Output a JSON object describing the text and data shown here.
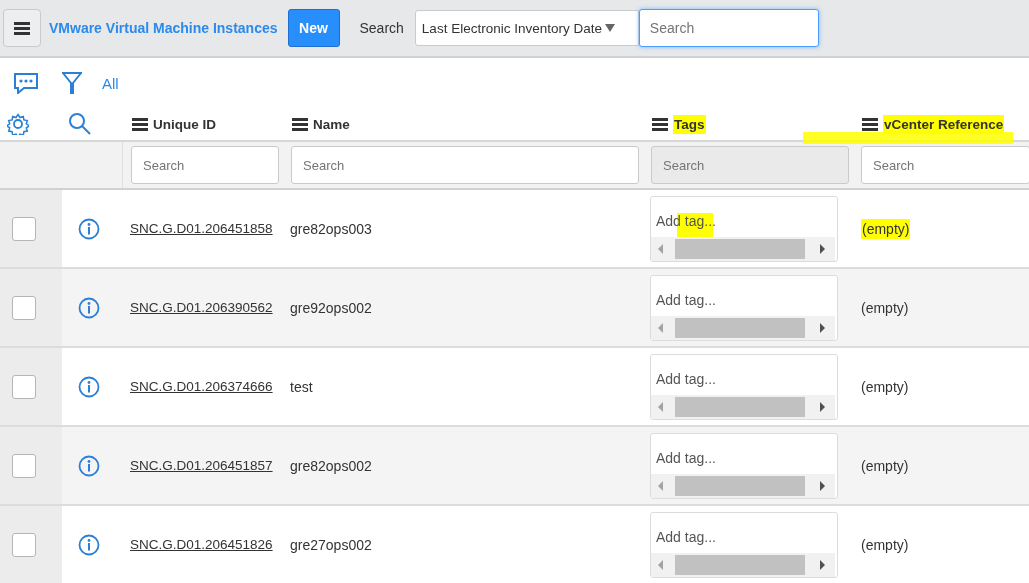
{
  "header": {
    "title": "VMware Virtual Machine Instances",
    "new_button": "New",
    "search_label": "Search",
    "search_field": "Last Electronic Inventory Date",
    "search_placeholder": "Search"
  },
  "breadcrumb": "All",
  "columns": [
    {
      "label": "Unique ID",
      "filter_placeholder": "Search",
      "filter_disabled": false,
      "highlighted": false
    },
    {
      "label": "Name",
      "filter_placeholder": "Search",
      "filter_disabled": false,
      "highlighted": false
    },
    {
      "label": "Tags",
      "filter_placeholder": "Search",
      "filter_disabled": true,
      "highlighted": true
    },
    {
      "label": "vCenter Reference",
      "filter_placeholder": "Search",
      "filter_disabled": false,
      "highlighted": true
    }
  ],
  "rows": [
    {
      "checked": false,
      "unique_id": "SNC.G.D01.206451858",
      "name": "gre82ops003",
      "tag_placeholder": "Add tag...",
      "tag_highlighted": true,
      "vcenter": "(empty)",
      "vcenter_highlighted": true
    },
    {
      "checked": false,
      "unique_id": "SNC.G.D01.206390562",
      "name": "gre92ops002",
      "tag_placeholder": "Add tag...",
      "tag_highlighted": false,
      "vcenter": "(empty)",
      "vcenter_highlighted": false
    },
    {
      "checked": false,
      "unique_id": "SNC.G.D01.206374666",
      "name": "test",
      "tag_placeholder": "Add tag...",
      "tag_highlighted": false,
      "vcenter": "(empty)",
      "vcenter_highlighted": false
    },
    {
      "checked": false,
      "unique_id": "SNC.G.D01.206451857",
      "name": "gre82ops002",
      "tag_placeholder": "Add tag...",
      "tag_highlighted": false,
      "vcenter": "(empty)",
      "vcenter_highlighted": false
    },
    {
      "checked": false,
      "unique_id": "SNC.G.D01.206451826",
      "name": "gre27ops002",
      "tag_placeholder": "Add tag...",
      "tag_highlighted": false,
      "vcenter": "(empty)",
      "vcenter_highlighted": false
    }
  ]
}
